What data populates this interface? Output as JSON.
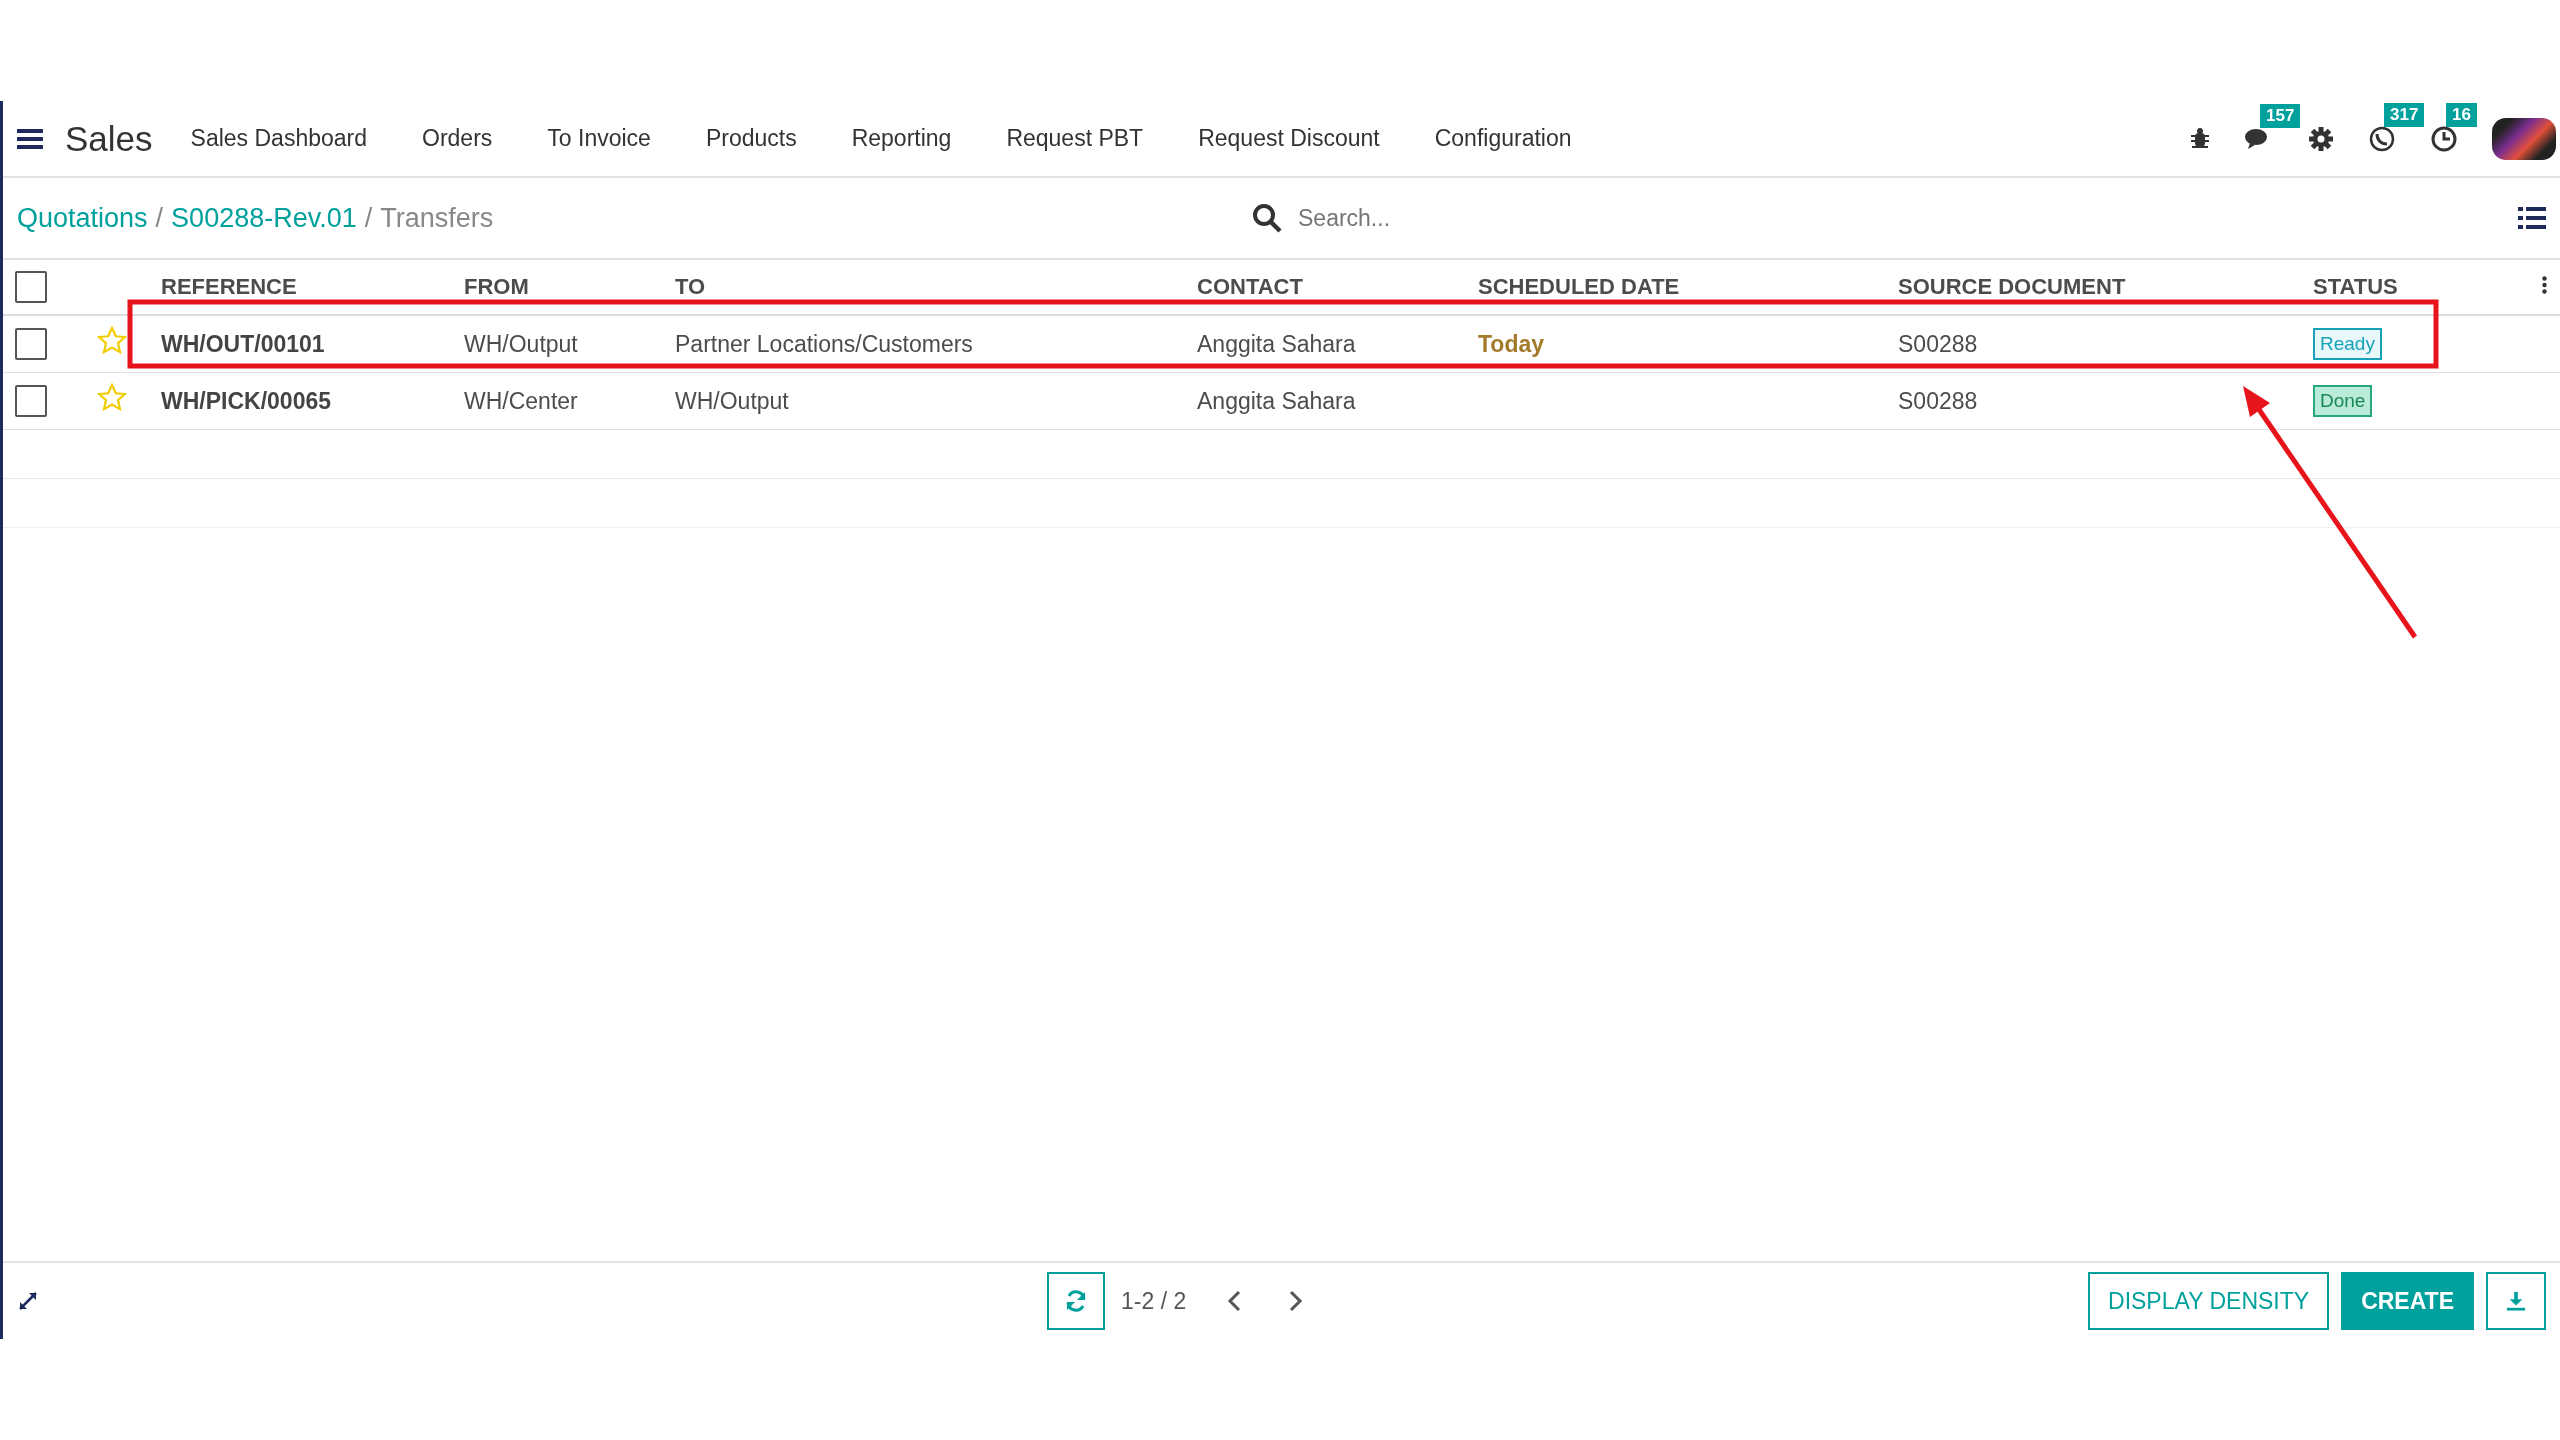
{
  "app": {
    "title": "Sales"
  },
  "menu": [
    "Sales Dashboard",
    "Orders",
    "To Invoice",
    "Products",
    "Reporting",
    "Request PBT",
    "Request Discount",
    "Configuration"
  ],
  "systray": [
    {
      "kind": "bug"
    },
    {
      "kind": "chat",
      "badge": "157"
    },
    {
      "kind": "gear"
    },
    {
      "kind": "phone",
      "badge": "317"
    },
    {
      "kind": "clock",
      "badge": "16"
    },
    {
      "kind": "avatar"
    }
  ],
  "breadcrumbs": [
    {
      "kind": "link",
      "label": "Quotations"
    },
    {
      "kind": "separator",
      "label": "/"
    },
    {
      "kind": "link",
      "label": "S00288-Rev.01"
    },
    {
      "kind": "separator",
      "label": "/"
    },
    {
      "kind": "current",
      "label": "Transfers"
    }
  ],
  "search": {
    "placeholder": "Search..."
  },
  "table": {
    "select_all": {
      "checked": false
    },
    "columns": [
      "REFERENCE",
      "FROM",
      "TO",
      "CONTACT",
      "SCHEDULED DATE",
      "SOURCE DOCUMENT",
      "STATUS"
    ],
    "rows": [
      {
        "checked": false,
        "starred": false,
        "reference": "WH/OUT/00101",
        "from": "WH/Output",
        "to": "Partner Locations/Customers",
        "contact": "Anggita Sahara",
        "scheduled_date": "Today",
        "source_document": "S00288",
        "status": {
          "label": "Ready",
          "kind": "ready"
        },
        "highlighted": true
      },
      {
        "checked": false,
        "starred": false,
        "reference": "WH/PICK/00065",
        "from": "WH/Center",
        "to": "WH/Output",
        "contact": "Anggita Sahara",
        "source_document": "S00288",
        "status": {
          "label": "Done",
          "kind": "done"
        },
        "highlighted": false
      }
    ]
  },
  "pager": {
    "range": "1-2 / 2"
  },
  "buttons": [
    {
      "kind": "secondary",
      "label": "DISPLAY DENSITY"
    },
    {
      "kind": "primary",
      "label": "CREATE"
    },
    {
      "kind": "icon"
    }
  ]
}
